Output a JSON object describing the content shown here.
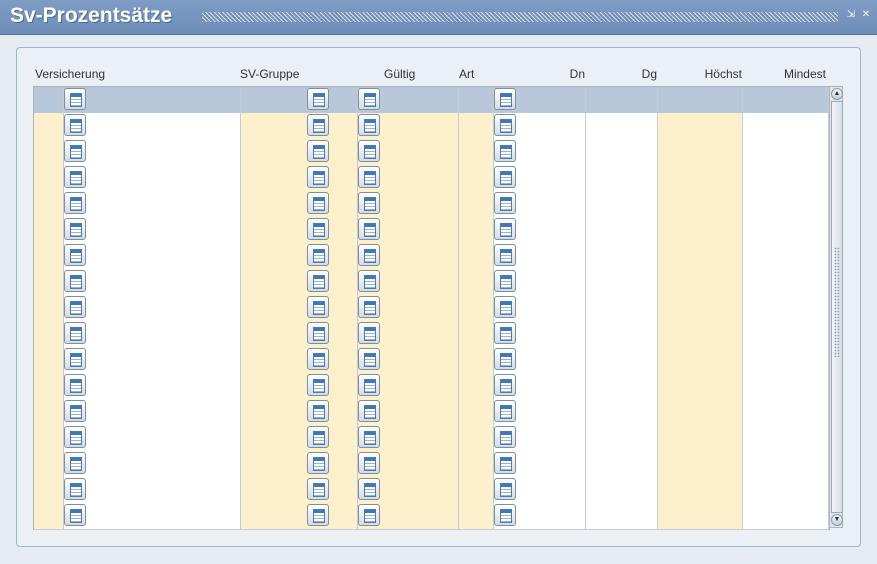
{
  "window": {
    "title": "Sv-Prozentsätze",
    "minimize_glyph": "⇲",
    "close_glyph": "✕"
  },
  "columns": [
    "Versicherung",
    "SV-Gruppe",
    "Gültig",
    "Art",
    "Dn",
    "Dg",
    "Höchst",
    "Mindest"
  ],
  "grid": {
    "rows": [
      {
        "versicherung": "",
        "sv_gruppe": "",
        "gueltig": "",
        "art": "",
        "dn": "",
        "dg": "",
        "hoechst": "",
        "mindest": ""
      },
      {
        "versicherung": "",
        "sv_gruppe": "",
        "gueltig": "",
        "art": "",
        "dn": "",
        "dg": "",
        "hoechst": "",
        "mindest": ""
      },
      {
        "versicherung": "",
        "sv_gruppe": "",
        "gueltig": "",
        "art": "",
        "dn": "",
        "dg": "",
        "hoechst": "",
        "mindest": ""
      },
      {
        "versicherung": "",
        "sv_gruppe": "",
        "gueltig": "",
        "art": "",
        "dn": "",
        "dg": "",
        "hoechst": "",
        "mindest": ""
      },
      {
        "versicherung": "",
        "sv_gruppe": "",
        "gueltig": "",
        "art": "",
        "dn": "",
        "dg": "",
        "hoechst": "",
        "mindest": ""
      },
      {
        "versicherung": "",
        "sv_gruppe": "",
        "gueltig": "",
        "art": "",
        "dn": "",
        "dg": "",
        "hoechst": "",
        "mindest": ""
      },
      {
        "versicherung": "",
        "sv_gruppe": "",
        "gueltig": "",
        "art": "",
        "dn": "",
        "dg": "",
        "hoechst": "",
        "mindest": ""
      },
      {
        "versicherung": "",
        "sv_gruppe": "",
        "gueltig": "",
        "art": "",
        "dn": "",
        "dg": "",
        "hoechst": "",
        "mindest": ""
      },
      {
        "versicherung": "",
        "sv_gruppe": "",
        "gueltig": "",
        "art": "",
        "dn": "",
        "dg": "",
        "hoechst": "",
        "mindest": ""
      },
      {
        "versicherung": "",
        "sv_gruppe": "",
        "gueltig": "",
        "art": "",
        "dn": "",
        "dg": "",
        "hoechst": "",
        "mindest": ""
      },
      {
        "versicherung": "",
        "sv_gruppe": "",
        "gueltig": "",
        "art": "",
        "dn": "",
        "dg": "",
        "hoechst": "",
        "mindest": ""
      },
      {
        "versicherung": "",
        "sv_gruppe": "",
        "gueltig": "",
        "art": "",
        "dn": "",
        "dg": "",
        "hoechst": "",
        "mindest": ""
      },
      {
        "versicherung": "",
        "sv_gruppe": "",
        "gueltig": "",
        "art": "",
        "dn": "",
        "dg": "",
        "hoechst": "",
        "mindest": ""
      },
      {
        "versicherung": "",
        "sv_gruppe": "",
        "gueltig": "",
        "art": "",
        "dn": "",
        "dg": "",
        "hoechst": "",
        "mindest": ""
      },
      {
        "versicherung": "",
        "sv_gruppe": "",
        "gueltig": "",
        "art": "",
        "dn": "",
        "dg": "",
        "hoechst": "",
        "mindest": ""
      },
      {
        "versicherung": "",
        "sv_gruppe": "",
        "gueltig": "",
        "art": "",
        "dn": "",
        "dg": "",
        "hoechst": "",
        "mindest": ""
      },
      {
        "versicherung": "",
        "sv_gruppe": "",
        "gueltig": "",
        "art": "",
        "dn": "",
        "dg": "",
        "hoechst": "",
        "mindest": ""
      }
    ],
    "selected_row": 0,
    "lov_icon": "list-of-values-icon"
  },
  "colors": {
    "title_bar": "#7e9cc4",
    "editable_cell": "#fdf0cd",
    "selected_row": "#b8c8da"
  }
}
